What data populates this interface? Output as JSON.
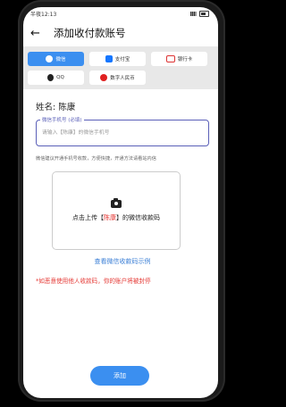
{
  "status": {
    "time": "半夜12:13"
  },
  "header": {
    "title": "添加收付款账号"
  },
  "tabs": [
    {
      "label": "微信",
      "icon": "wechat-icon",
      "active": true
    },
    {
      "label": "支付宝",
      "icon": "alipay-icon",
      "active": false
    },
    {
      "label": "银行卡",
      "icon": "bank-card-icon",
      "active": false
    },
    {
      "label": "QQ",
      "icon": "qq-icon",
      "active": false
    },
    {
      "label": "数字人民币",
      "icon": "digital-rmb-icon",
      "active": false
    }
  ],
  "form": {
    "name_label": "姓名: 陈康",
    "phone_label": "微信手机号 (必填)",
    "phone_placeholder": "请输入【陈康】的微信手机号",
    "tip": "微信建议开通手机号收款，方便快捷，开通方法请看站内信"
  },
  "upload": {
    "prefix": "点击上传【",
    "highlight": "陈康",
    "suffix": "】的微信收款码"
  },
  "example_link": "查看微信收款码示例",
  "warning": "*如恶意使用他人收款码，你的账户将被封停",
  "submit_label": "添加",
  "colors": {
    "accent": "#3b8ff0",
    "warning": "#e53935",
    "link": "#3b7fd6"
  }
}
